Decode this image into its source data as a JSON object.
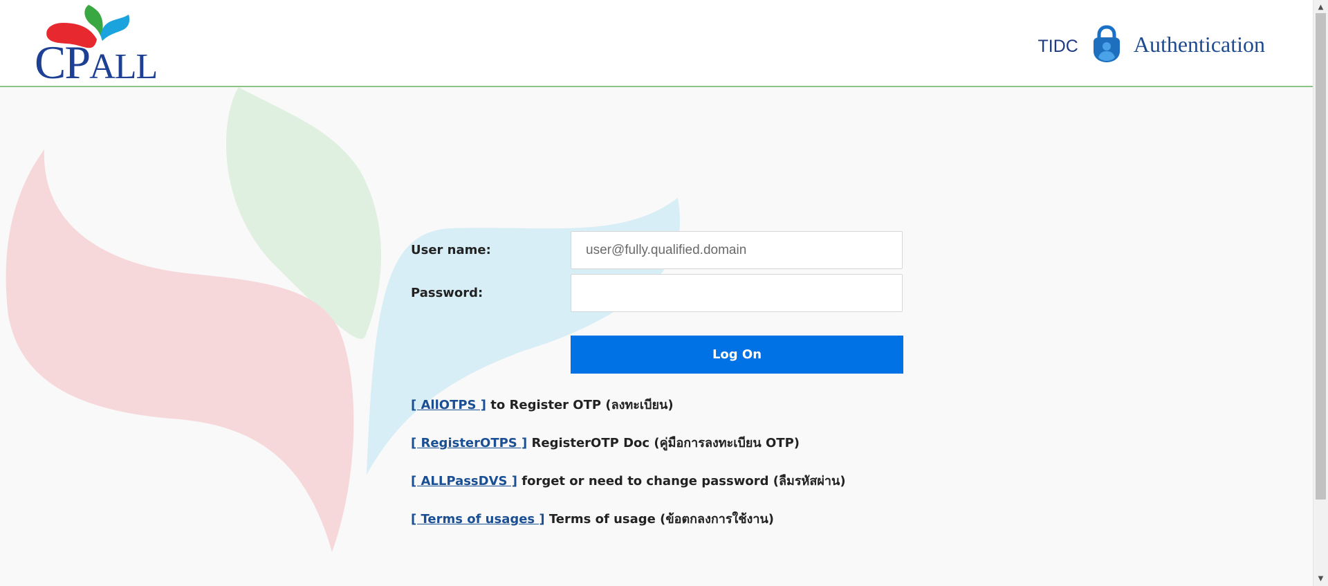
{
  "header": {
    "logo_text_big": "CP",
    "logo_text_small": "ALL",
    "brand_prefix": "TIDC",
    "brand_title": "Authentication"
  },
  "form": {
    "username_label": "User name:",
    "username_placeholder": "user@fully.qualified.domain",
    "username_value": "",
    "password_label": "Password:",
    "password_value": "",
    "submit_label": "Log On"
  },
  "links": [
    {
      "link_text": "[ AllOTPS ]",
      "description": "to Register OTP (ลงทะเบียน)"
    },
    {
      "link_text": "[ RegisterOTPS ]",
      "description": "RegisterOTP Doc (คู่มือการลงทะเบียน OTP)"
    },
    {
      "link_text": "[ ALLPassDVS ]",
      "description": "forget or need to change password (ลืมรหัสผ่าน)"
    },
    {
      "link_text": "[ Terms of usages ]",
      "description": "Terms of usage (ข้อตกลงการใช้งาน)"
    }
  ],
  "icons": {
    "logo": "cpall-leaf-logo-icon",
    "lock": "authenticator-lock-icon",
    "scroll_up": "scroll-up-arrow-icon",
    "scroll_down": "scroll-down-arrow-icon"
  },
  "colors": {
    "primary_button": "#0072e5",
    "link": "#1b4f93",
    "header_rule": "#8cc485",
    "brand_blue": "#1d3f94",
    "leaf_red": "#e8282f",
    "leaf_green": "#3aa842",
    "leaf_blue": "#1aa3dc"
  },
  "scrollbar": {
    "position_fraction": 0.0
  }
}
